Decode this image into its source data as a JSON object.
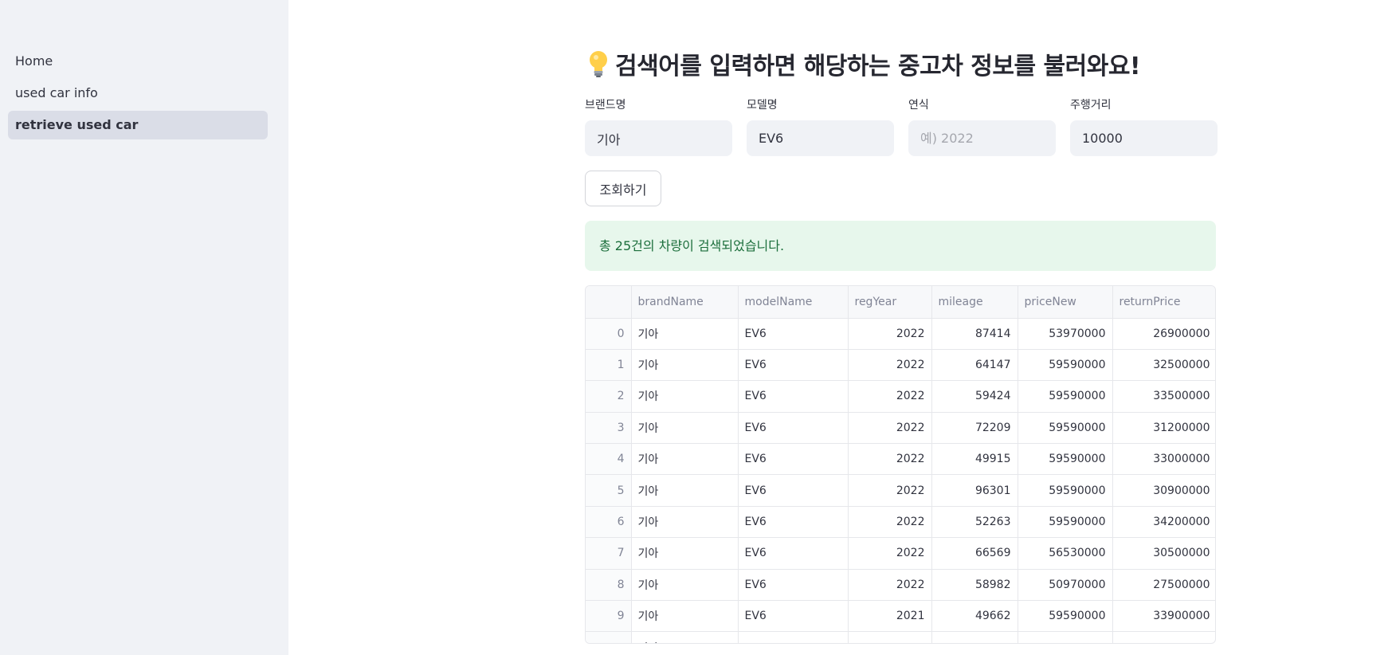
{
  "sidebar": {
    "items": [
      {
        "label": "Home",
        "active": false
      },
      {
        "label": "used car info",
        "active": false
      },
      {
        "label": "retrieve used car",
        "active": true
      }
    ]
  },
  "main": {
    "title": "검색어를 입력하면 해당하는 중고차 정보를 불러와요!",
    "title_icon": "lightbulb-icon",
    "fields": [
      {
        "label": "브랜드명",
        "value": "기아",
        "placeholder": ""
      },
      {
        "label": "모델명",
        "value": "EV6",
        "placeholder": ""
      },
      {
        "label": "연식",
        "value": "",
        "placeholder": "예) 2022"
      },
      {
        "label": "주행거리",
        "value": "10000",
        "placeholder": ""
      }
    ],
    "search_button": "조회하기",
    "result_message": "총 25건의 차량이 검색되었습니다.",
    "table": {
      "columns": [
        "",
        "brandName",
        "modelName",
        "regYear",
        "mileage",
        "priceNew",
        "returnPrice"
      ],
      "rows": [
        [
          "0",
          "기아",
          "EV6",
          "2022",
          "87414",
          "53970000",
          "26900000"
        ],
        [
          "1",
          "기아",
          "EV6",
          "2022",
          "64147",
          "59590000",
          "32500000"
        ],
        [
          "2",
          "기아",
          "EV6",
          "2022",
          "59424",
          "59590000",
          "33500000"
        ],
        [
          "3",
          "기아",
          "EV6",
          "2022",
          "72209",
          "59590000",
          "31200000"
        ],
        [
          "4",
          "기아",
          "EV6",
          "2022",
          "49915",
          "59590000",
          "33000000"
        ],
        [
          "5",
          "기아",
          "EV6",
          "2022",
          "96301",
          "59590000",
          "30900000"
        ],
        [
          "6",
          "기아",
          "EV6",
          "2022",
          "52263",
          "59590000",
          "34200000"
        ],
        [
          "7",
          "기아",
          "EV6",
          "2022",
          "66569",
          "56530000",
          "30500000"
        ],
        [
          "8",
          "기아",
          "EV6",
          "2022",
          "58982",
          "50970000",
          "27500000"
        ],
        [
          "9",
          "기아",
          "EV6",
          "2021",
          "49662",
          "59590000",
          "33900000"
        ]
      ],
      "partial_row_brand": "기아"
    }
  },
  "colors": {
    "sidebar_bg": "#f0f2f6",
    "active_nav_bg": "#dadde7",
    "success_bg": "#e7f7ec",
    "success_text": "#1b6e3b"
  }
}
